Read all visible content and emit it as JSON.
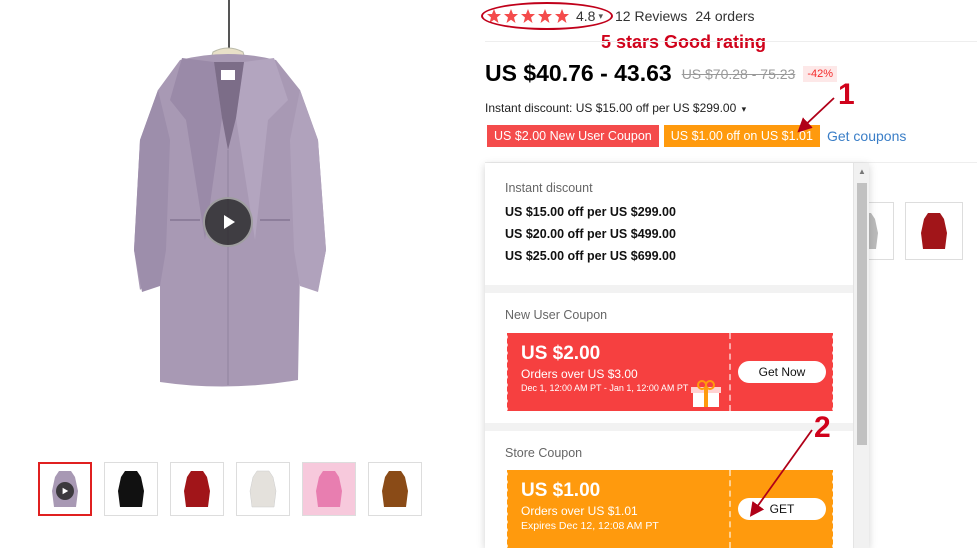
{
  "rating": {
    "stars": 5,
    "value": "4.8",
    "reviews": "12 Reviews",
    "orders": "24 orders"
  },
  "annotations": {
    "rating_note": "5 stars Good rating",
    "marker_1": "1",
    "marker_2": "2",
    "color": "#d0021b"
  },
  "price": {
    "range": "US $40.76 - 43.63",
    "original": "US $70.28 - 75.23",
    "discount": "-42%"
  },
  "instant_discount_label": "Instant discount: US $15.00 off per US $299.00",
  "coupon_tags": {
    "new_user": "US $2.00 New User Coupon",
    "store": "US $1.00 off on US $1.01",
    "get_coupons": "Get coupons"
  },
  "dropdown": {
    "instant": {
      "title": "Instant discount",
      "lines": [
        "US $15.00 off per US $299.00",
        "US $20.00 off per US $499.00",
        "US $25.00 off per US $699.00"
      ]
    },
    "new_user": {
      "title": "New User Coupon",
      "amount": "US $2.00",
      "condition": "Orders over US $3.00",
      "dates": "Dec 1, 12:00 AM PT - Jan 1, 12:00 AM PT",
      "button": "Get Now"
    },
    "store": {
      "title": "Store Coupon",
      "amount": "US $1.00",
      "condition": "Orders over US $1.01",
      "expires": "Expires Dec 12, 12:08 AM PT",
      "button": "GET"
    }
  },
  "colors": {
    "accent_red": "#f44b4b",
    "accent_orange": "#ff9a0d",
    "link_blue": "#3a7ec7",
    "star_red": "#f44b4b"
  },
  "thumbnails": [
    "lilac-coat",
    "black-coat",
    "red-coat",
    "white-coat",
    "pink-coat",
    "brown-coat"
  ]
}
